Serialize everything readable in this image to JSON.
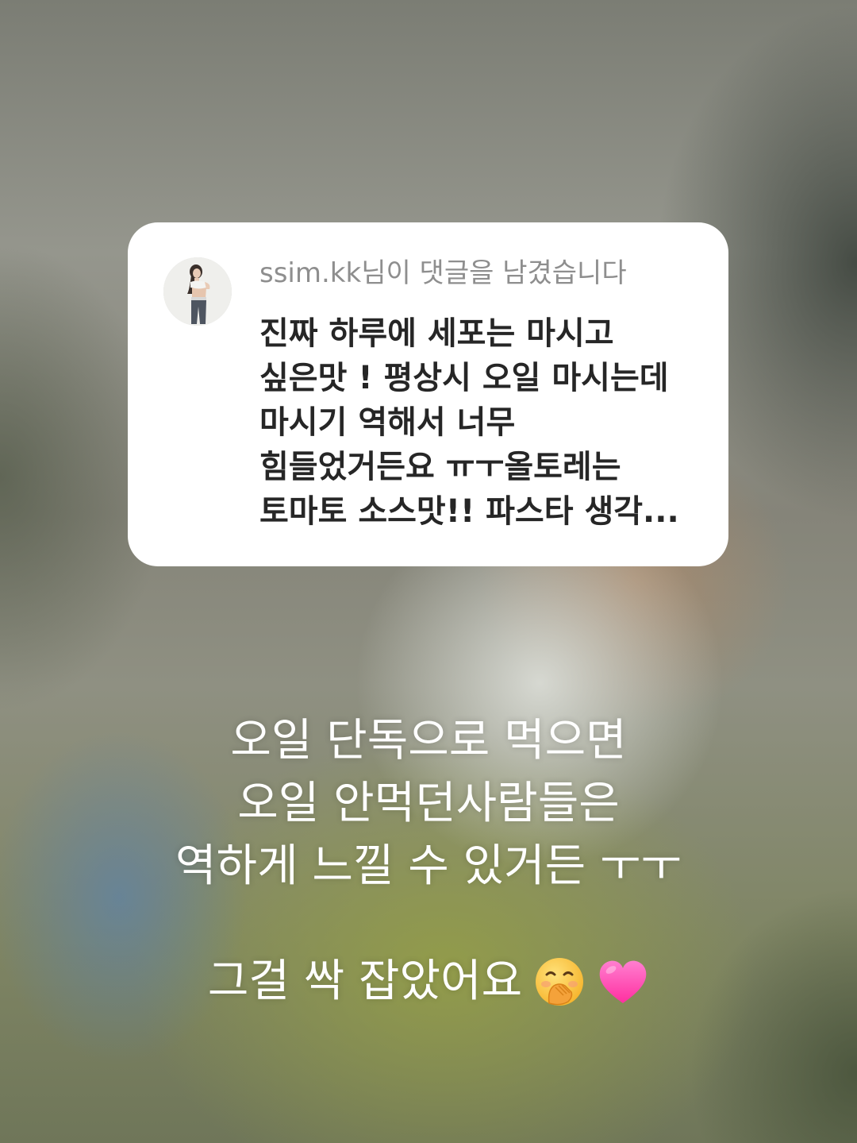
{
  "comment_card": {
    "username": "ssim.kk",
    "action_text": "님이 댓글을 남겼습니다",
    "comment_lines": [
      "진짜 하루에 세포는 마시고",
      "싶은맛 ! 평상시 오일 마시는데",
      "마시기 역해서 너무",
      "힘들었거든요 ㅠㅜ올토레는",
      "토마토 소스맛!! 파스타 생각..."
    ]
  },
  "reply": {
    "lines": [
      "오일 단독으로 먹으면",
      "오일 안먹던사람들은",
      "역하게 느낄 수 있거든 ㅜㅜ"
    ],
    "last_line": "그걸 싹 잡았어요"
  },
  "icons": [
    "avatar-photo",
    "hand-over-mouth-emoji-icon",
    "pink-heart-icon"
  ],
  "colors": {
    "card_background": "#ffffff",
    "header_text": "#8e8e8e",
    "comment_text": "#262626",
    "reply_text": "#ffffff",
    "heart": "#ff4fb5"
  }
}
